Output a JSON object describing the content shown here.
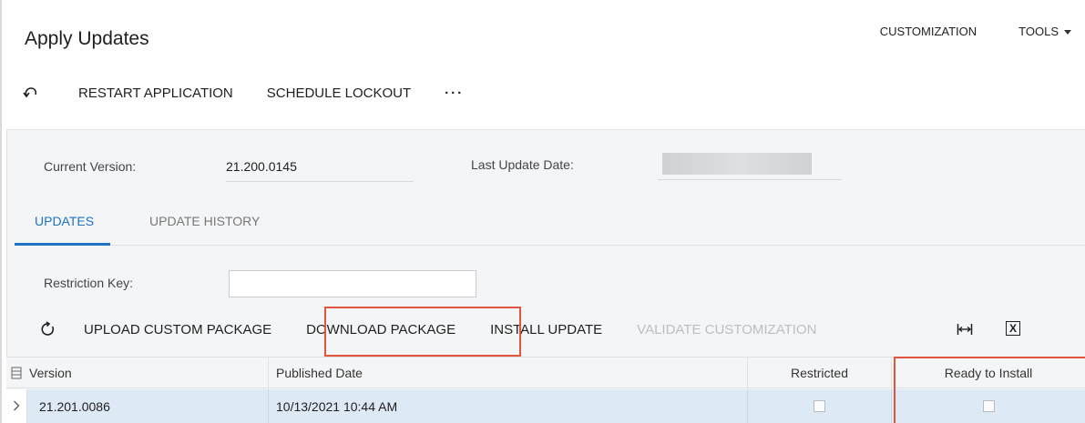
{
  "page": {
    "title": "Apply Updates",
    "top_links": [
      {
        "label": "CUSTOMIZATION"
      },
      {
        "label": "TOOLS"
      }
    ]
  },
  "toolbar": {
    "undo_icon": "undo-icon",
    "restart_label": "RESTART APPLICATION",
    "schedule_label": "SCHEDULE LOCKOUT",
    "more_label": "···"
  },
  "summary": {
    "current_version_label": "Current Version:",
    "current_version_value": "21.200.0145",
    "last_update_label": "Last Update Date:",
    "last_update_value": ""
  },
  "tabs": [
    {
      "label": "UPDATES",
      "active": true
    },
    {
      "label": "UPDATE HISTORY",
      "active": false
    }
  ],
  "restriction": {
    "label": "Restriction Key:",
    "value": ""
  },
  "grid_toolbar": {
    "refresh_icon": "refresh-icon",
    "upload_label": "UPLOAD CUSTOM PACKAGE",
    "download_label": "DOWNLOAD PACKAGE",
    "install_label": "INSTALL UPDATE",
    "validate_label": "VALIDATE CUSTOMIZATION",
    "fit_icon": "fit-columns-icon",
    "excel_icon": "excel-export-icon",
    "excel_glyph": "X"
  },
  "grid": {
    "columns": [
      "Version",
      "Published Date",
      "Restricted",
      "Ready to Install"
    ],
    "rows": [
      {
        "version": "21.201.0086",
        "published": "10/13/2021 10:44 AM",
        "restricted": false,
        "ready": false
      }
    ]
  },
  "colors": {
    "accent": "#1e73c4",
    "highlight": "#e2553d",
    "selected_row": "#dde9f5"
  }
}
